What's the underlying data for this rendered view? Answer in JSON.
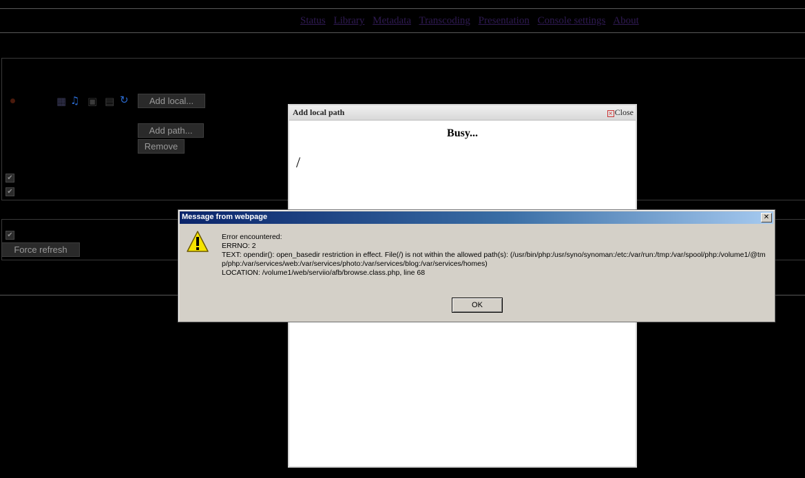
{
  "nav": {
    "items": [
      "Status",
      "Library",
      "Metadata",
      "Transcoding",
      "Presentation",
      "Console settings",
      "About"
    ],
    "link_color": "#2f1a52"
  },
  "library": {
    "add_local_label": "Add local...",
    "add_path_label": "Add path...",
    "remove_label": "Remove",
    "force_refresh_label": "Force refresh",
    "icons": [
      "video-icon",
      "music-icon",
      "image-icon",
      "document-icon",
      "refresh-icon"
    ]
  },
  "dialog": {
    "title": "Add local path",
    "close_label": "Close",
    "status": "Busy...",
    "path": "/"
  },
  "message": {
    "title": "Message from webpage",
    "close_glyph": "✕",
    "lines": [
      "Error encountered:",
      "ERRNO: 2",
      "TEXT: opendir(): open_basedir restriction in effect. File(/) is not within the allowed path(s): (/usr/bin/php:/usr/syno/synoman:/etc:/var/run:/tmp:/var/spool/php:/volume1/@tmp/php:/var/services/web:/var/services/photo:/var/services/blog:/var/services/homes)",
      "LOCATION: /volume1/web/serviio/afb/browse.class.php, line 68"
    ],
    "ok_label": "OK",
    "icon": "warning-icon"
  },
  "colors": {
    "page_background": "#000000",
    "msg_titlebar_start": "#0a246a",
    "msg_titlebar_end": "#a6caf0",
    "dialog_background": "#ffffff"
  }
}
